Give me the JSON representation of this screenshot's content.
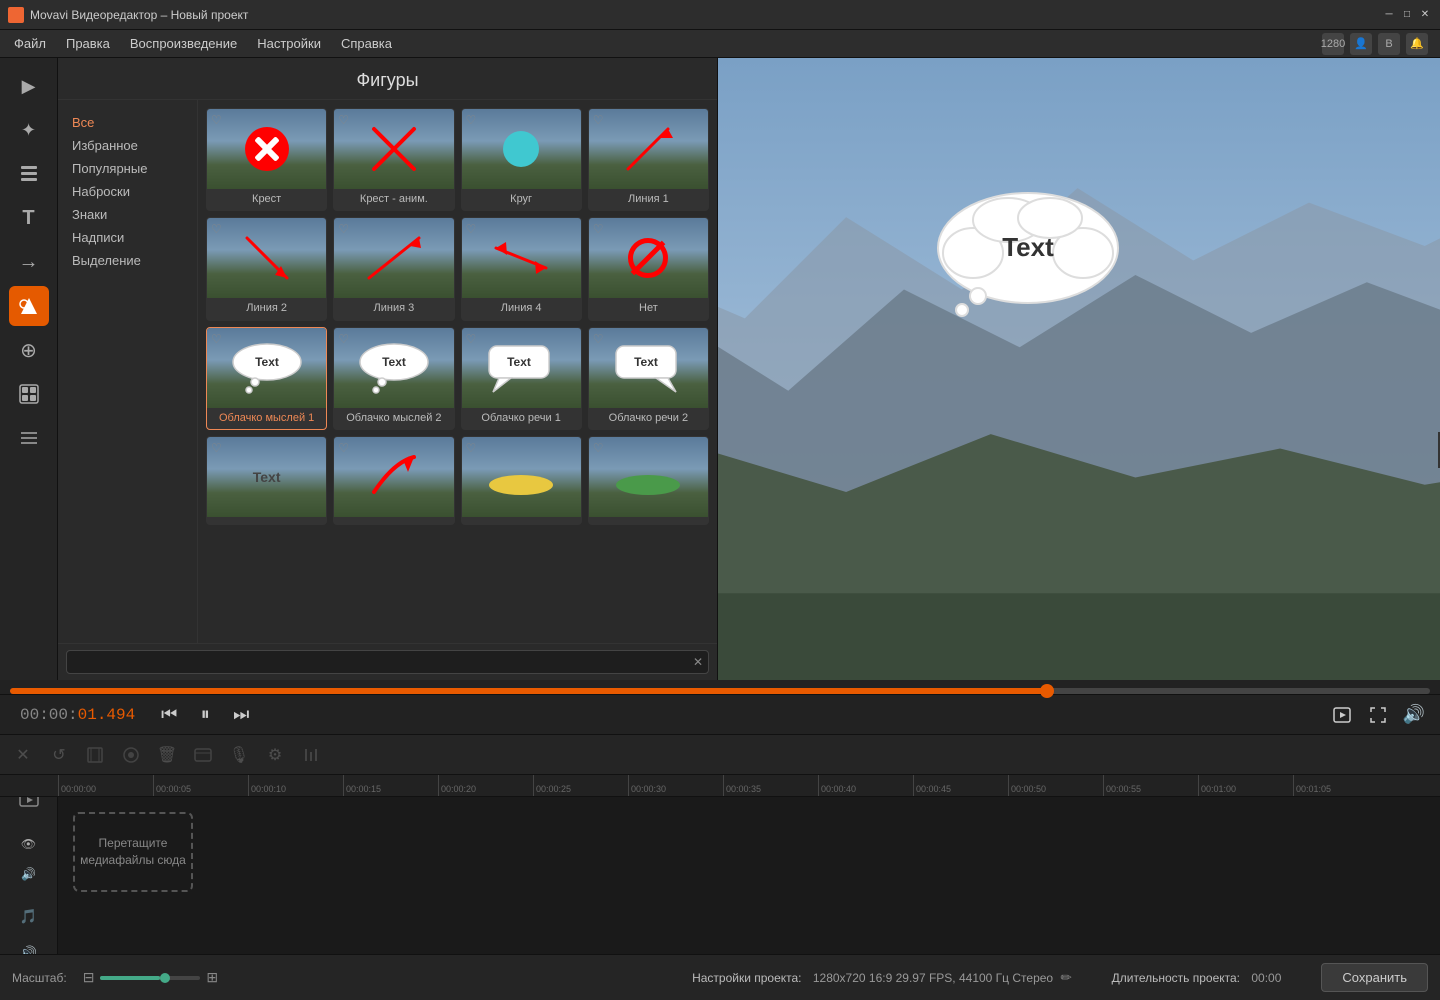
{
  "titleBar": {
    "icon": "▶",
    "title": "Movavi Видеоредактор – Новый проект",
    "minimize": "─",
    "maximize": "□",
    "close": "✕"
  },
  "menuBar": {
    "items": [
      "Файл",
      "Правка",
      "Воспроизведение",
      "Настройки",
      "Справка"
    ],
    "rightIcons": [
      "1280",
      "👤",
      "B",
      "🔔"
    ]
  },
  "panel": {
    "title": "Фигуры",
    "categories": [
      {
        "label": "Все",
        "active": true
      },
      {
        "label": "Избранное"
      },
      {
        "label": "Популярные"
      },
      {
        "label": "Наброски"
      },
      {
        "label": "Знаки"
      },
      {
        "label": "Надписи"
      },
      {
        "label": "Выделение"
      }
    ],
    "search": {
      "placeholder": ""
    }
  },
  "shapes": [
    {
      "id": 1,
      "label": "Крест",
      "type": "cross-x"
    },
    {
      "id": 2,
      "label": "Крест - аним.",
      "type": "cross-line"
    },
    {
      "id": 3,
      "label": "Круг",
      "type": "circle-cyan"
    },
    {
      "id": 4,
      "label": "Линия 1",
      "type": "line1"
    },
    {
      "id": 5,
      "label": "Линия 2",
      "type": "line2"
    },
    {
      "id": 6,
      "label": "Линия 3",
      "type": "line3"
    },
    {
      "id": 7,
      "label": "Линия 4",
      "type": "line4"
    },
    {
      "id": 8,
      "label": "Нет",
      "type": "no-sign"
    },
    {
      "id": 9,
      "label": "Облачко мыслей 1",
      "type": "thought1",
      "active": true
    },
    {
      "id": 10,
      "label": "Облачко мыслей 2",
      "type": "thought2"
    },
    {
      "id": 11,
      "label": "Облачко речи 1",
      "type": "speech1"
    },
    {
      "id": 12,
      "label": "Облачко речи 2",
      "type": "speech2"
    },
    {
      "id": 13,
      "label": "...",
      "type": "text-plain"
    },
    {
      "id": 14,
      "label": "...",
      "type": "arc-red"
    },
    {
      "id": 15,
      "label": "...",
      "type": "oval-yellow"
    },
    {
      "id": 16,
      "label": "...",
      "type": "shape-green"
    }
  ],
  "previewText": "Text",
  "timeDisplay": {
    "current": "01.494",
    "prefix": "00:00:"
  },
  "playback": {
    "progress": 73,
    "progressThumb": 73
  },
  "ruler": {
    "marks": [
      "00:00:00",
      "00:00:05",
      "00:00:10",
      "00:00:15",
      "00:00:20",
      "00:00:25",
      "00:00:30",
      "00:00:35",
      "00:00:40",
      "00:00:45",
      "00:00:50",
      "00:00:55",
      "00:01:00",
      "00:01:05"
    ]
  },
  "statusBar": {
    "scaleLabel": "Масштаб:",
    "projectSettingsLabel": "Настройки проекта:",
    "projectSettings": "1280x720 16:9 29.97 FPS, 44100 Гц Стерео",
    "durationLabel": "Длительность проекта:",
    "duration": "00:00",
    "saveBtn": "Сохранить"
  },
  "dropZone": {
    "text": "Перетащите медиафайлы сюда"
  },
  "tools": [
    {
      "icon": "▶",
      "label": "video-tool"
    },
    {
      "icon": "✦",
      "label": "effects-tool"
    },
    {
      "icon": "✂",
      "label": "cut-tool"
    },
    {
      "icon": "T",
      "label": "text-tool"
    },
    {
      "icon": "→",
      "label": "transition-tool"
    },
    {
      "icon": "◬",
      "label": "shapes-tool",
      "active": true
    },
    {
      "icon": "⊕",
      "label": "zoom-tool"
    },
    {
      "icon": "⊞",
      "label": "filter-tool"
    },
    {
      "icon": "≡",
      "label": "audio-tool"
    }
  ]
}
